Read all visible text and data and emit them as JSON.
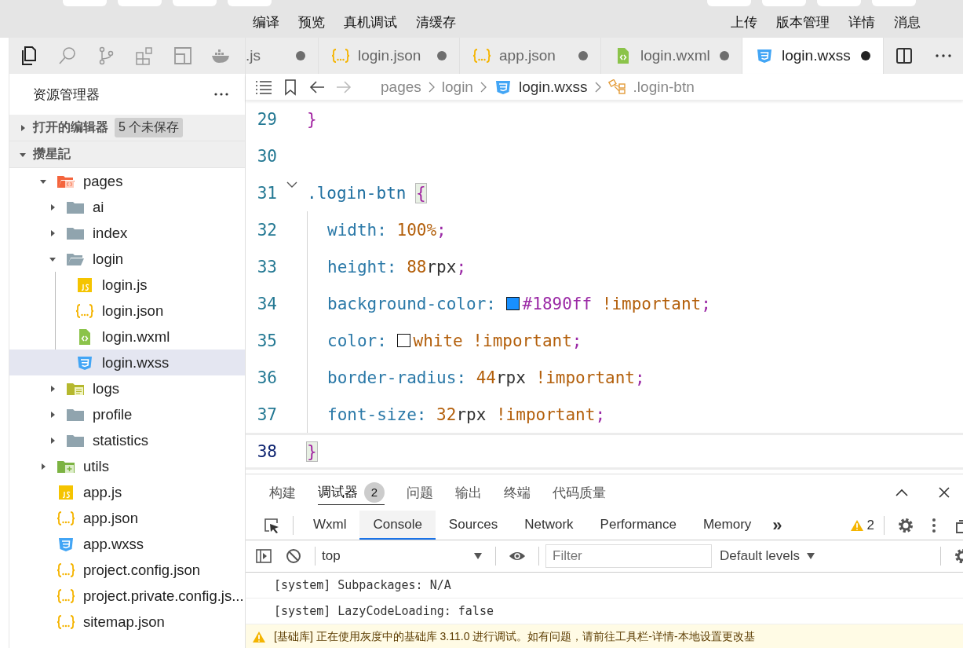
{
  "toolbar": {
    "left_buttons": [
      "编译",
      "预览",
      "真机调试",
      "清缓存"
    ],
    "right_buttons": [
      "上传",
      "版本管理",
      "详情",
      "消息"
    ]
  },
  "activity_bar": [
    {
      "kind": "files",
      "selected": true
    },
    {
      "kind": "search",
      "selected": false
    },
    {
      "kind": "branch",
      "selected": false
    },
    {
      "kind": "extensions",
      "selected": false
    },
    {
      "kind": "layout",
      "selected": false
    },
    {
      "kind": "whale",
      "selected": false
    }
  ],
  "editor_tabs": [
    {
      "label": ".js",
      "kind": "none",
      "modified": true,
      "selected": false
    },
    {
      "label": "login.json",
      "kind": "json",
      "modified": true,
      "selected": false
    },
    {
      "label": "app.json",
      "kind": "json",
      "modified": true,
      "selected": false
    },
    {
      "label": "login.wxml",
      "kind": "wxml",
      "modified": true,
      "selected": false
    },
    {
      "label": "login.wxss",
      "kind": "wxss",
      "modified": true,
      "selected": true
    }
  ],
  "explorer": {
    "title": "资源管理器",
    "open_editors": {
      "label": "打开的编辑器",
      "expanded": false,
      "badge": "5 个未保存"
    },
    "project": {
      "label": "攒星記",
      "expanded": true
    },
    "tree": [
      {
        "name": "pages",
        "kind": "pages-folder",
        "expanded": true,
        "selected": false,
        "children": [
          {
            "name": "ai",
            "kind": "folder",
            "expanded": false,
            "selected": false
          },
          {
            "name": "index",
            "kind": "folder",
            "expanded": false,
            "selected": false
          },
          {
            "name": "login",
            "kind": "folder",
            "expanded": true,
            "selected": false,
            "children": [
              {
                "name": "login.js",
                "kind": "js",
                "selected": false
              },
              {
                "name": "login.json",
                "kind": "json",
                "selected": false
              },
              {
                "name": "login.wxml",
                "kind": "wxml",
                "selected": false
              },
              {
                "name": "login.wxss",
                "kind": "wxss",
                "selected": true
              }
            ]
          },
          {
            "name": "logs",
            "kind": "logs-folder",
            "expanded": false,
            "selected": false
          },
          {
            "name": "profile",
            "kind": "folder",
            "expanded": false,
            "selected": false
          },
          {
            "name": "statistics",
            "kind": "folder",
            "expanded": false,
            "selected": false
          }
        ]
      },
      {
        "name": "utils",
        "kind": "utils-folder",
        "expanded": false,
        "selected": false
      },
      {
        "name": "app.js",
        "kind": "js",
        "selected": false
      },
      {
        "name": "app.json",
        "kind": "json",
        "selected": false
      },
      {
        "name": "app.wxss",
        "kind": "wxss",
        "selected": false
      },
      {
        "name": "project.config.json",
        "kind": "json",
        "selected": false
      },
      {
        "name": "project.private.config.js...",
        "kind": "json",
        "selected": false
      },
      {
        "name": "sitemap.json",
        "kind": "json",
        "selected": false
      }
    ]
  },
  "breadcrumb": [
    {
      "text": "pages",
      "kind": "folder"
    },
    {
      "text": "login",
      "kind": "folder"
    },
    {
      "text": "login.wxss",
      "kind": "wxss"
    },
    {
      "text": ".login-btn",
      "kind": "selector"
    }
  ],
  "code_lines": [
    {
      "number": "29",
      "current": false,
      "foldable": false,
      "indent": false,
      "tokens": [
        {
          "kind": "brace",
          "text": "}",
          "matched": false
        }
      ]
    },
    {
      "number": "30",
      "current": false,
      "foldable": false,
      "indent": false
    },
    {
      "number": "31",
      "current": false,
      "foldable": true,
      "indent": false,
      "tokens": [
        {
          "kind": "selector",
          "text": ".login-btn "
        },
        {
          "kind": "brace",
          "text": "{",
          "matched": true
        }
      ]
    },
    {
      "number": "32",
      "current": false,
      "foldable": false,
      "indent": true,
      "tokens": [
        {
          "kind": "property",
          "text": "width"
        },
        {
          "kind": "colon",
          "text": ": "
        },
        {
          "kind": "number",
          "text": "100%"
        },
        {
          "kind": "semicolon",
          "text": ";"
        }
      ]
    },
    {
      "number": "33",
      "current": false,
      "foldable": false,
      "indent": true,
      "tokens": [
        {
          "kind": "property",
          "text": "height"
        },
        {
          "kind": "colon",
          "text": ": "
        },
        {
          "kind": "number",
          "text": "88"
        },
        {
          "kind": "unit",
          "text": "rpx"
        },
        {
          "kind": "semicolon",
          "text": ";"
        }
      ]
    },
    {
      "number": "34",
      "current": false,
      "foldable": false,
      "indent": true,
      "tokens": [
        {
          "kind": "property",
          "text": "background-color"
        },
        {
          "kind": "colon",
          "text": ": "
        },
        {
          "kind": "swatch",
          "color": "#1890ff"
        },
        {
          "kind": "hex",
          "text": "#1890ff"
        },
        {
          "kind": "keyword",
          "text": " !important"
        },
        {
          "kind": "semicolon",
          "text": ";"
        }
      ]
    },
    {
      "number": "35",
      "current": false,
      "foldable": false,
      "indent": true,
      "tokens": [
        {
          "kind": "property",
          "text": "color"
        },
        {
          "kind": "colon",
          "text": ": "
        },
        {
          "kind": "swatch",
          "color": "#ffffff"
        },
        {
          "kind": "keyword",
          "text": "white !important"
        },
        {
          "kind": "semicolon",
          "text": ";"
        }
      ]
    },
    {
      "number": "36",
      "current": false,
      "foldable": false,
      "indent": true,
      "tokens": [
        {
          "kind": "property",
          "text": "border-radius"
        },
        {
          "kind": "colon",
          "text": ": "
        },
        {
          "kind": "number",
          "text": "44"
        },
        {
          "kind": "unit",
          "text": "rpx"
        },
        {
          "kind": "keyword",
          "text": " !important"
        },
        {
          "kind": "semicolon",
          "text": ";"
        }
      ]
    },
    {
      "number": "37",
      "current": false,
      "foldable": false,
      "indent": true,
      "tokens": [
        {
          "kind": "property",
          "text": "font-size"
        },
        {
          "kind": "colon",
          "text": ": "
        },
        {
          "kind": "number",
          "text": "32"
        },
        {
          "kind": "unit",
          "text": "rpx"
        },
        {
          "kind": "keyword",
          "text": " !important"
        },
        {
          "kind": "semicolon",
          "text": ";"
        }
      ]
    },
    {
      "number": "38",
      "current": true,
      "foldable": false,
      "indent": false,
      "tokens": [
        {
          "kind": "brace",
          "text": "}",
          "matched": true
        }
      ]
    }
  ],
  "panel": {
    "tabs": [
      {
        "label": "构建",
        "selected": false
      },
      {
        "label": "调试器",
        "selected": true,
        "badge": "2"
      },
      {
        "label": "问题",
        "selected": false
      },
      {
        "label": "输出",
        "selected": false
      },
      {
        "label": "终端",
        "selected": false
      },
      {
        "label": "代码质量",
        "selected": false
      }
    ],
    "devtools_tabs": [
      {
        "label": "Wxml",
        "selected": false
      },
      {
        "label": "Console",
        "selected": true
      },
      {
        "label": "Sources",
        "selected": false
      },
      {
        "label": "Network",
        "selected": false
      },
      {
        "label": "Performance",
        "selected": false
      },
      {
        "label": "Memory",
        "selected": false
      }
    ],
    "more_tabs": "»",
    "warning_count": "2",
    "console": {
      "context": "top",
      "filter_placeholder": "Filter",
      "levels": "Default levels"
    },
    "logs": [
      {
        "kind": "info",
        "text": "[system] Subpackages: N/A"
      },
      {
        "kind": "info",
        "text": "[system] LazyCodeLoading: false"
      },
      {
        "kind": "warning",
        "text": "[基础库] 正在使用灰度中的基础库 3.11.0 进行调试。如有问题，请前往工具栏-详情-本地设置更改基"
      }
    ]
  }
}
